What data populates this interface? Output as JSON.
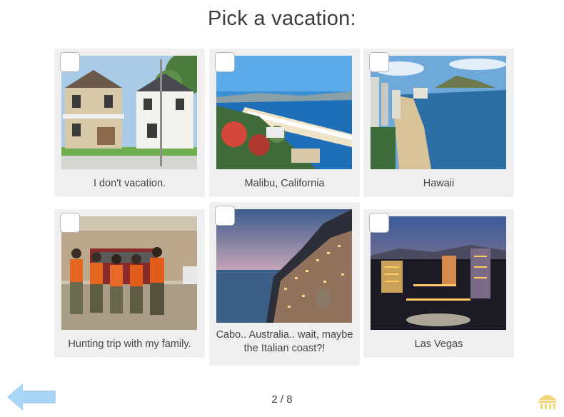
{
  "question": "Pick a vacation:",
  "options": [
    {
      "label": "I don't vacation.",
      "image": "suburban-house-photo",
      "checked": false
    },
    {
      "label": "Malibu, California",
      "image": "malibu-coast-photo",
      "checked": false
    },
    {
      "label": "Hawaii",
      "image": "hawaii-beach-photo",
      "checked": false
    },
    {
      "label": "Hunting trip with my family.",
      "image": "hunting-group-photo",
      "checked": false
    },
    {
      "label": "Cabo.. Australia.. wait, maybe the Italian coast?!",
      "image": "italian-coast-photo",
      "checked": false
    },
    {
      "label": "Las Vegas",
      "image": "las-vegas-night-photo",
      "checked": false
    }
  ],
  "progress": "2 / 8",
  "icons": {
    "back": "back-arrow-icon",
    "logo": "brand-logo-icon"
  },
  "colors": {
    "card_bg": "#efefef",
    "back_arrow": "#a8d4f5",
    "logo": "#f4d67a",
    "text": "#444444"
  }
}
